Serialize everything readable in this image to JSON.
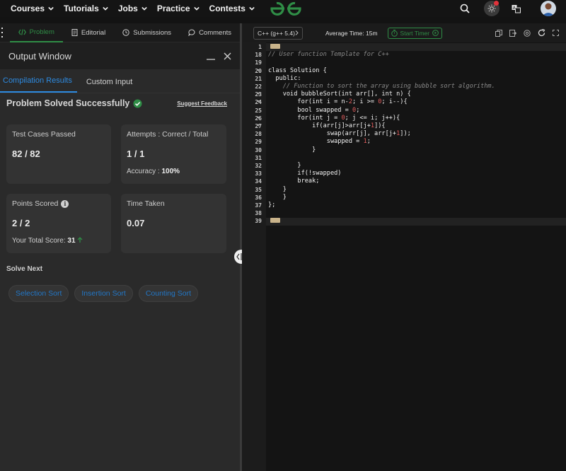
{
  "nav": {
    "items": [
      {
        "label": "Courses"
      },
      {
        "label": "Tutorials"
      },
      {
        "label": "Jobs"
      },
      {
        "label": "Practice"
      },
      {
        "label": "Contests"
      }
    ],
    "logo_icon": "gfg-logo",
    "brand_color": "#2f8d46"
  },
  "left_tabs": [
    {
      "label": "Problem",
      "icon": "code-icon",
      "active": true
    },
    {
      "label": "Editorial",
      "icon": "document-icon"
    },
    {
      "label": "Submissions",
      "icon": "clock-icon"
    },
    {
      "label": "Comments",
      "icon": "comment-icon"
    }
  ],
  "output": {
    "title": "Output Window",
    "tabs": [
      "Compilation Results",
      "Custom Input"
    ],
    "status": "Problem Solved Successfully",
    "feedback": "Suggest Feedback",
    "cards": {
      "tests_label": "Test Cases Passed",
      "tests_value": "82 / 82",
      "attempts_label": "Attempts : Correct / Total",
      "attempts_value": "1 / 1",
      "accuracy_label": "Accuracy :",
      "accuracy_value": "100%",
      "points_label": "Points Scored",
      "points_value": "2 / 2",
      "total_label": "Your Total Score:",
      "total_value": "31",
      "time_label": "Time Taken",
      "time_value": "0.07"
    },
    "solve_next_label": "Solve Next",
    "solve_next": [
      "Selection Sort",
      "Insertion Sort",
      "Counting Sort"
    ]
  },
  "editor": {
    "language": "C++ (g++ 5.4)",
    "avg_time": "Average Time: 15m",
    "start_timer": "Start Timer",
    "lines": [
      {
        "n": "1",
        "text": ""
      },
      {
        "n": "18",
        "text": "// User function Template for C++"
      },
      {
        "n": "19",
        "text": ""
      },
      {
        "n": "20",
        "text": "class Solution {"
      },
      {
        "n": "21",
        "text": "  public:"
      },
      {
        "n": "22",
        "text": "    // Function to sort the array using bubble sort algorithm."
      },
      {
        "n": "23",
        "text": "    void bubbleSort(int arr[], int n) {"
      },
      {
        "n": "24",
        "text": "        for(int i = n-2; i >= 0; i--){"
      },
      {
        "n": "25",
        "text": "        bool swapped = 0;"
      },
      {
        "n": "26",
        "text": "        for(int j = 0; j <= i; j++){"
      },
      {
        "n": "27",
        "text": "            if(arr[j]>arr[j+1]){"
      },
      {
        "n": "28",
        "text": "                swap(arr[j], arr[j+1]);"
      },
      {
        "n": "29",
        "text": "                swapped = 1;"
      },
      {
        "n": "30",
        "text": "            }"
      },
      {
        "n": "31",
        "text": ""
      },
      {
        "n": "32",
        "text": "        }"
      },
      {
        "n": "33",
        "text": "        if(!swapped)"
      },
      {
        "n": "34",
        "text": "        break;"
      },
      {
        "n": "35",
        "text": "    }"
      },
      {
        "n": "36",
        "text": "    }"
      },
      {
        "n": "37",
        "text": "};"
      },
      {
        "n": "38",
        "text": ""
      },
      {
        "n": "39",
        "text": ""
      }
    ]
  }
}
